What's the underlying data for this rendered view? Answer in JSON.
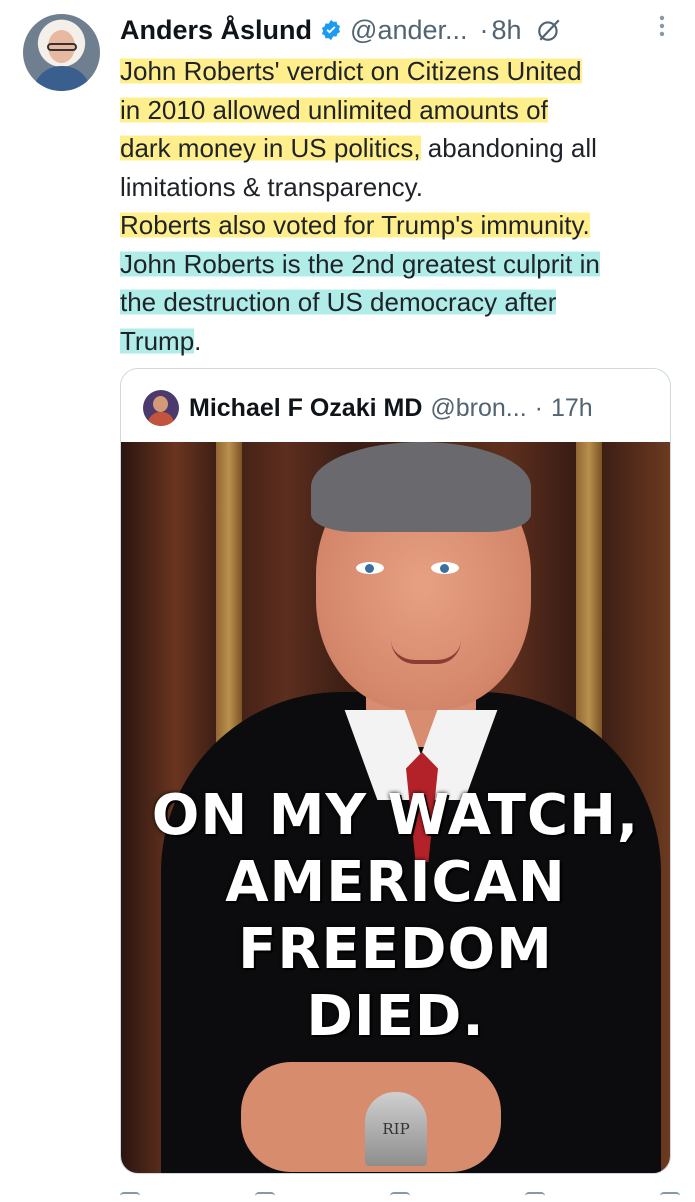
{
  "tweet": {
    "author_name": "Anders Åslund",
    "handle": "@ander...",
    "time": "8h",
    "dot": "·",
    "lines": [
      "John Roberts' verdict on Citizens United",
      "in 2010 allowed unlimited amounts of",
      "dark money in US politics,",
      " abandoning all",
      "limitations & transparency.",
      "Roberts also voted for Trump's immunity.",
      "John Roberts is the 2nd greatest culprit in",
      "the destruction of US democracy after",
      "Trump",
      "."
    ]
  },
  "quoted": {
    "author_name": "Michael F Ozaki MD",
    "handle": "@bron...",
    "dot": "·",
    "time": "17h",
    "image_caption": [
      "ON MY WATCH,",
      "AMERICAN",
      "FREEDOM",
      "DIED."
    ],
    "tombstone": "RIP"
  },
  "icons": [
    "verified-badge-icon",
    "grok-icon",
    "more-icon"
  ],
  "colors": {
    "verified": "#1d9bf0",
    "secondary_text": "#536471",
    "highlight_yellow": "#ffec78",
    "highlight_teal": "#96e6e1"
  }
}
